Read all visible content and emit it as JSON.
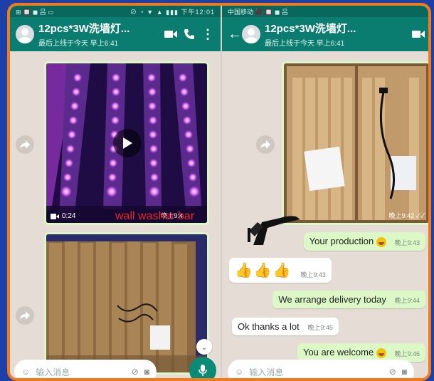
{
  "left": {
    "status_left": "⊞ 🔲 ◼ 吕 ▭",
    "status_right": "⊘ ◔ ▼ ▲ ▮▮▮ 下午12:01",
    "title": "12pcs*3W洗墙灯...",
    "subtitle": "最后上线于今天 早上6:41",
    "video_duration": "0:24",
    "video_time": "晚上9:4",
    "input_placeholder": "输入消息"
  },
  "right": {
    "status_text": "中国移动 ⬛ 🔲 ◼ 吕",
    "title": "12pcs*3W洗墙灯...",
    "subtitle": "最后上线于今天 早上6:41",
    "image_time": "晚上9:42",
    "messages": [
      {
        "text": "Your production",
        "time": "晚上9:43",
        "dir": "out"
      },
      {
        "text": "",
        "time": "晚上9:43",
        "dir": "in"
      },
      {
        "text": "We arrange delivery today",
        "time": "晚上9:44",
        "dir": "out"
      },
      {
        "text": "Ok thanks a lot",
        "time": "晚上9:45",
        "dir": "in"
      },
      {
        "text": "You are welcome",
        "time": "晚上9:46",
        "dir": "out"
      }
    ],
    "input_placeholder": "输入消息"
  },
  "overlay": {
    "label": "wall washer bar"
  },
  "colors": {
    "header": "#0b7d70",
    "frame": "#f07a1c",
    "outgoing": "#dcf8c6",
    "incoming": "#ffffff"
  }
}
